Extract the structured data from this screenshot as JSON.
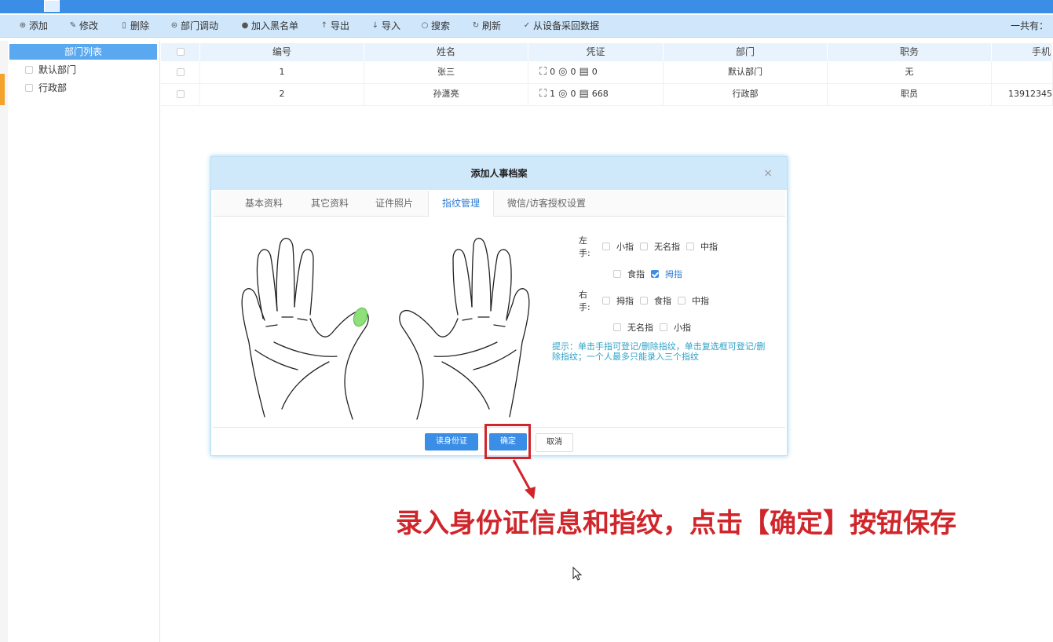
{
  "toolbar": {
    "items": [
      {
        "icon": "plus-circle-icon",
        "glyph": "⊕",
        "label": "添加"
      },
      {
        "icon": "pencil-icon",
        "glyph": "✎",
        "label": "修改"
      },
      {
        "icon": "trash-icon",
        "glyph": "🗑",
        "label": "删除"
      },
      {
        "icon": "transfer-icon",
        "glyph": "⊜",
        "label": "部门调动"
      },
      {
        "icon": "blacklist-icon",
        "glyph": "●",
        "label": "加入黑名单"
      },
      {
        "icon": "export-icon",
        "glyph": "↑",
        "label": "导出"
      },
      {
        "icon": "import-icon",
        "glyph": "↓",
        "label": "导入"
      },
      {
        "icon": "search-icon",
        "glyph": "○",
        "label": "搜索"
      },
      {
        "icon": "refresh-icon",
        "glyph": "↻",
        "label": "刷新"
      },
      {
        "icon": "check-icon",
        "glyph": "✓",
        "label": "从设备采回数据"
      }
    ],
    "total_label": "一共有："
  },
  "sidebar": {
    "header": "部门列表",
    "items": [
      {
        "label": "默认部门"
      },
      {
        "label": "行政部"
      }
    ]
  },
  "table": {
    "columns": [
      "编号",
      "姓名",
      "凭证",
      "部门",
      "职务",
      "手机"
    ],
    "rows": [
      {
        "id": "1",
        "name": "张三",
        "face": "0",
        "finger": "0",
        "card": "0",
        "dept": "默认部门",
        "title": "无",
        "phone": ""
      },
      {
        "id": "2",
        "name": "孙潇亮",
        "face": "1",
        "finger": "0",
        "card": "668",
        "dept": "行政部",
        "title": "职员",
        "phone": "13912345"
      }
    ]
  },
  "dialog": {
    "title": "添加人事档案",
    "close": "×",
    "tabs": [
      "基本资料",
      "其它资料",
      "证件照片",
      "指纹管理",
      "微信/访客授权设置"
    ],
    "active_tab": "指纹管理",
    "left_hand_label": "左手:",
    "right_hand_label": "右手:",
    "left_fingers_row1": [
      "小指",
      "无名指",
      "中指"
    ],
    "left_fingers_row2": [
      "食指",
      "拇指"
    ],
    "right_fingers_row1": [
      "拇指",
      "食指",
      "中指"
    ],
    "right_fingers_row2": [
      "无名指",
      "小指"
    ],
    "checked_finger": "左手拇指",
    "hint": "提示：单击手指可登记/删除指纹，单击复选框可登记/删除指纹；一个人最多只能录入三个指纹",
    "buttons": {
      "read_id": "读身份证",
      "confirm": "确定",
      "cancel": "取消"
    }
  },
  "annotation": {
    "caption": "录入身份证信息和指纹，点击【确定】按钮保存",
    "color": "#d0262b"
  },
  "colors": {
    "accent": "#3a8ee6",
    "toolbar_bg": "#cfe6fb",
    "hint": "#2fa3c6"
  }
}
